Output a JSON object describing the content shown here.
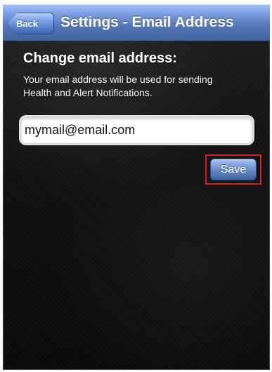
{
  "header": {
    "back_label": "Back",
    "title": "Settings - Email Address"
  },
  "main": {
    "heading": "Change email address:",
    "description": "Your email address will be used for sending\nHealth and Alert Notifications.",
    "email_value": "mymail@email.com",
    "save_label": "Save"
  },
  "colors": {
    "navbar_blue": "#5376ba",
    "background_dark": "#121212",
    "highlight_red": "#df1c1c"
  }
}
